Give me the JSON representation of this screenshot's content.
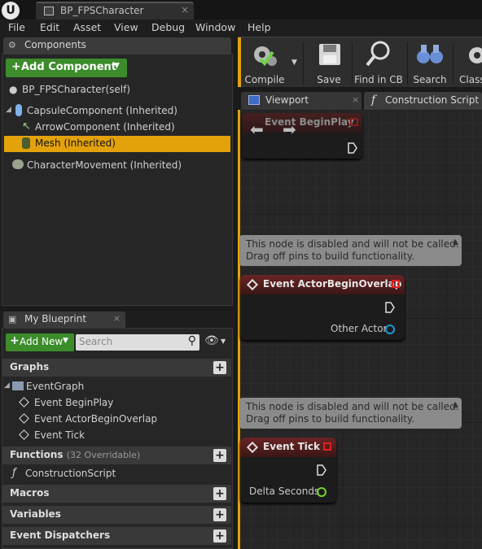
{
  "title_bar": {
    "logo_glyph": "U",
    "document_tab": {
      "label": "BP_FPSCharacter",
      "close": "×"
    }
  },
  "menu": [
    "File",
    "Edit",
    "Asset",
    "View",
    "Debug",
    "Window",
    "Help"
  ],
  "components_panel": {
    "tab_label": "Components",
    "tab_close": "×",
    "add_button": "Add Component",
    "tree": [
      {
        "label": "BP_FPSCharacter(self)",
        "icon": "person-icon"
      },
      {
        "label": "CapsuleComponent (Inherited)",
        "icon": "capsule-icon"
      },
      {
        "label": "ArrowComponent (Inherited)",
        "icon": "arrow-icon"
      },
      {
        "label": "Mesh (Inherited)",
        "icon": "mesh-icon",
        "selected": true
      },
      {
        "label": "CharacterMovement (Inherited)",
        "icon": "movement-icon"
      }
    ]
  },
  "my_blueprint_panel": {
    "tab_label": "My Blueprint",
    "tab_close": "×",
    "add_new_button": "Add New",
    "search_placeholder": "Search",
    "sections": {
      "graphs": {
        "label": "Graphs",
        "items": [
          "EventGraph",
          "Event BeginPlay",
          "Event ActorBeginOverlap",
          "Event Tick"
        ]
      },
      "functions": {
        "label": "Functions",
        "overridable": "(32 Overridable)",
        "items": [
          "ConstructionScript"
        ]
      },
      "macros": {
        "label": "Macros"
      },
      "variables": {
        "label": "Variables"
      },
      "dispatchers": {
        "label": "Event Dispatchers"
      }
    }
  },
  "toolbar": {
    "buttons": [
      "Compile",
      "Save",
      "Find in CB",
      "Search",
      "Class"
    ]
  },
  "editor_tabs": [
    {
      "label": "Viewport",
      "close": "×"
    },
    {
      "label": "Construction Script"
    }
  ],
  "graph": {
    "nodes": {
      "begin_play": {
        "title": "Event BeginPlay"
      },
      "begin_overlap": {
        "title": "Event ActorBeginOverlap",
        "comment": [
          "This node is disabled and will not be called.",
          "Drag off pins to build functionality."
        ],
        "output_pin": "Other Actor"
      },
      "tick": {
        "title": "Event Tick",
        "comment": [
          "This node is disabled and will not be called.",
          "Drag off pins to build functionality."
        ],
        "output_pin": "Delta Seconds"
      }
    }
  },
  "colors": {
    "selection": "#e3a20b",
    "green_button": "#3c8c2c",
    "event_header": "#6a2424",
    "actor_pin": "#1a9ad6",
    "float_pin": "#7ad12a"
  }
}
